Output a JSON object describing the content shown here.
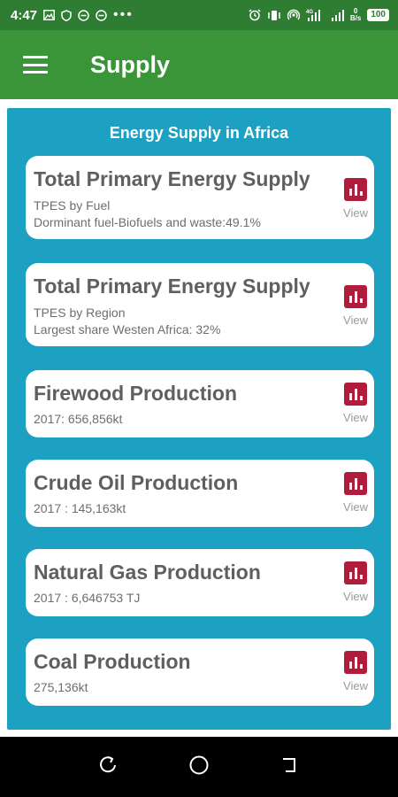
{
  "status_bar": {
    "time": "4:47",
    "network_speed_value": "0",
    "network_speed_unit": "B/s",
    "network_type": "4G",
    "battery": "100"
  },
  "app_bar": {
    "title": "Supply"
  },
  "panel": {
    "title": "Energy Supply in Africa"
  },
  "cards": [
    {
      "title": "Total Primary Energy Supply",
      "line1": "TPES by Fuel",
      "line2": "Dorminant fuel-Biofuels and waste:49.1%",
      "view_label": "View"
    },
    {
      "title": "Total Primary Energy Supply",
      "line1": "TPES by Region",
      "line2": "Largest share Westen Africa: 32%",
      "view_label": "View"
    },
    {
      "title": "Firewood Production",
      "line1": "2017: 656,856kt",
      "view_label": "View"
    },
    {
      "title": "Crude Oil Production",
      "line1": "2017 : 145,163kt",
      "view_label": "View"
    },
    {
      "title": "Natural Gas Production",
      "line1": "2017 : 6,646753 TJ",
      "view_label": "View"
    },
    {
      "title": "Coal Production",
      "line1": "275,136kt",
      "view_label": "View"
    }
  ],
  "colors": {
    "status_bar": "#2e7d32",
    "app_bar": "#3a9438",
    "panel": "#1da1c2",
    "chart_icon": "#b01c3c"
  },
  "icons": [
    "gallery-icon",
    "shield-icon",
    "minus-circle-icon",
    "alarm-icon",
    "vibrate-icon",
    "hotspot-icon",
    "signal-icon",
    "chart-icon",
    "recents-icon",
    "home-icon",
    "back-icon"
  ]
}
